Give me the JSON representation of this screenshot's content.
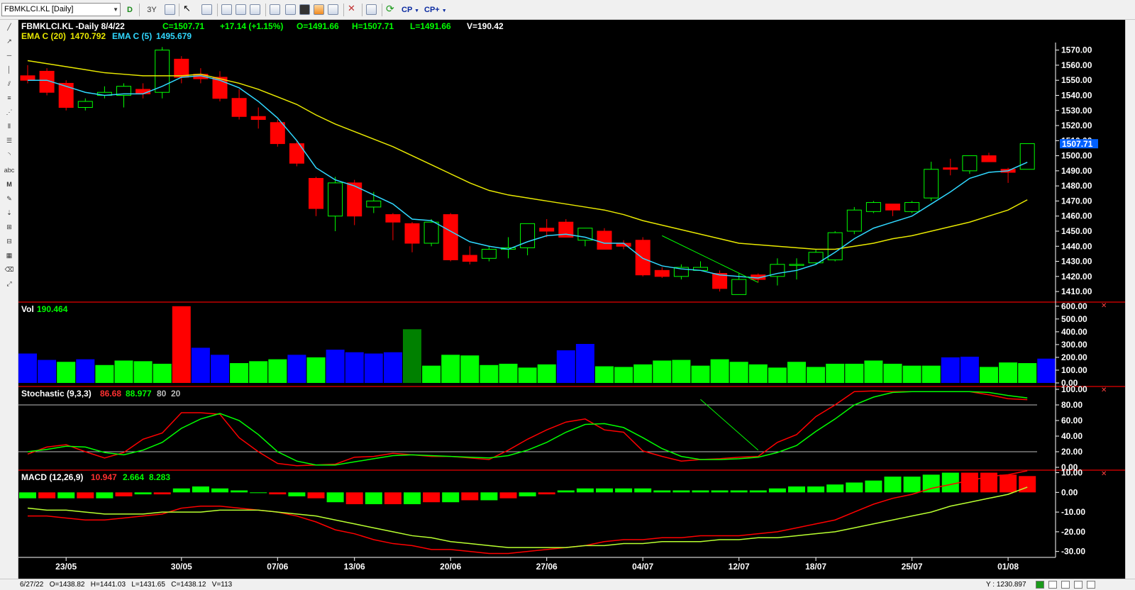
{
  "symbol_selector": {
    "value": "FBMKLCI.KL [Daily]"
  },
  "toolbar": {
    "period_label": "D",
    "range_label": "3Y",
    "cp_label": "CP",
    "cp_plus_label": "CP+"
  },
  "left_tools": {
    "text_tool_label": "abc",
    "m_tool_label": "M"
  },
  "header": {
    "title": "FBMKLCI.KL -Daily  8/4/22",
    "close": "C=1507.71",
    "change": "+17.14 (+1.15%)",
    "open": "O=1491.66",
    "high": "H=1507.71",
    "low": "L=1491.66",
    "volume": "V=190.42",
    "ema20_label": "EMA C (20)",
    "ema20_value": "1470.792",
    "ema5_label": "EMA C (5)",
    "ema5_value": "1495.679"
  },
  "panes": {
    "volume": {
      "label": "Vol",
      "value": "190.464"
    },
    "stochastic": {
      "label": "Stochastic (9,3,3)",
      "k": "86.68",
      "d": "88.977",
      "upper": "80",
      "lower": "20"
    },
    "macd": {
      "label": "MACD (12,26,9)",
      "macd": "10.947",
      "signal": "2.664",
      "hist": "8.283"
    }
  },
  "price_marker": "1507.71",
  "colors": {
    "up": "#00ff00",
    "down": "#ff0000",
    "ema20": "#e8e800",
    "ema5": "#30d8ff",
    "vol_blue": "#0000ff",
    "vol_dkgreen": "#008000",
    "grid": "#bbbbbb",
    "separator": "#c00000"
  },
  "status": {
    "ohlc": "6/27/22   O=1438.82   H=1441.03   L=1431.65   C=1438.12   V=113",
    "y_readout": "Y : 1230.897"
  },
  "chart_data": {
    "type": "candlestick",
    "x_labels": [
      "23/05",
      "30/05",
      "07/06",
      "13/06",
      "20/06",
      "27/06",
      "04/07",
      "12/07",
      "18/07",
      "25/07",
      "01/08"
    ],
    "x_label_index": [
      2,
      8,
      13,
      17,
      22,
      27,
      32,
      37,
      41,
      46,
      51
    ],
    "price": {
      "ylim": [
        1403,
        1575
      ],
      "ticks": [
        1410,
        1420,
        1430,
        1440,
        1450,
        1460,
        1470,
        1480,
        1490,
        1500,
        1510,
        1520,
        1530,
        1540,
        1550,
        1560,
        1570
      ],
      "ohlc": [
        [
          1553,
          1560,
          1548,
          1550
        ],
        [
          1556,
          1558,
          1540,
          1542
        ],
        [
          1548,
          1550,
          1530,
          1532
        ],
        [
          1532,
          1538,
          1530,
          1536
        ],
        [
          1540,
          1546,
          1538,
          1542
        ],
        [
          1540,
          1548,
          1532,
          1546
        ],
        [
          1544,
          1548,
          1538,
          1541
        ],
        [
          1542,
          1572,
          1538,
          1570
        ],
        [
          1564,
          1566,
          1548,
          1552
        ],
        [
          1554,
          1558,
          1548,
          1551
        ],
        [
          1552,
          1556,
          1536,
          1538
        ],
        [
          1538,
          1544,
          1524,
          1526
        ],
        [
          1526,
          1532,
          1518,
          1524
        ],
        [
          1522,
          1524,
          1506,
          1508
        ],
        [
          1508,
          1510,
          1493,
          1495
        ],
        [
          1485,
          1486,
          1460,
          1465
        ],
        [
          1460,
          1486,
          1450,
          1482
        ],
        [
          1482,
          1484,
          1454,
          1460
        ],
        [
          1466,
          1476,
          1462,
          1470
        ],
        [
          1461,
          1462,
          1444,
          1456
        ],
        [
          1455,
          1456,
          1436,
          1442
        ],
        [
          1442,
          1458,
          1440,
          1456
        ],
        [
          1461,
          1462,
          1430,
          1431
        ],
        [
          1434,
          1440,
          1428,
          1430
        ],
        [
          1432,
          1440,
          1430,
          1438
        ],
        [
          1438,
          1446,
          1432,
          1439
        ],
        [
          1439,
          1455,
          1434,
          1455
        ],
        [
          1452,
          1458,
          1446,
          1450
        ],
        [
          1456,
          1458,
          1446,
          1446
        ],
        [
          1444,
          1452,
          1440,
          1452
        ],
        [
          1450,
          1452,
          1440,
          1438
        ],
        [
          1442,
          1444,
          1438,
          1440
        ],
        [
          1444,
          1446,
          1420,
          1421
        ],
        [
          1424,
          1426,
          1419,
          1420
        ],
        [
          1420,
          1428,
          1418,
          1426
        ],
        [
          1424,
          1430,
          1424,
          1426
        ],
        [
          1422,
          1424,
          1410,
          1412
        ],
        [
          1408,
          1422,
          1408,
          1418
        ],
        [
          1421,
          1422,
          1416,
          1418
        ],
        [
          1420,
          1432,
          1414,
          1428
        ],
        [
          1428,
          1432,
          1418,
          1428
        ],
        [
          1429,
          1438,
          1428,
          1436
        ],
        [
          1431,
          1450,
          1430,
          1449
        ],
        [
          1450,
          1466,
          1448,
          1464
        ],
        [
          1463,
          1470,
          1462,
          1469
        ],
        [
          1468,
          1468,
          1460,
          1464
        ],
        [
          1463,
          1470,
          1462,
          1469
        ],
        [
          1472,
          1496,
          1470,
          1491
        ],
        [
          1492,
          1498,
          1487,
          1491
        ],
        [
          1490,
          1500,
          1488,
          1500
        ],
        [
          1500,
          1502,
          1496,
          1496
        ],
        [
          1491,
          1492,
          1482,
          1489
        ],
        [
          1491,
          1508,
          1491,
          1508
        ]
      ],
      "ema20": [
        1563,
        1561,
        1559,
        1557,
        1555,
        1554,
        1553,
        1553,
        1553,
        1554,
        1551,
        1548,
        1544,
        1539,
        1534,
        1527,
        1521,
        1516,
        1511,
        1506,
        1500,
        1494,
        1488,
        1482,
        1477,
        1474,
        1472,
        1470,
        1468,
        1466,
        1464,
        1461,
        1457,
        1454,
        1451,
        1448,
        1445,
        1442,
        1441,
        1440,
        1439,
        1438,
        1438,
        1440,
        1442,
        1445,
        1447,
        1450,
        1453,
        1456,
        1460,
        1464,
        1470.79
      ],
      "ema5": [
        1550,
        1550,
        1546,
        1542,
        1540,
        1541,
        1541,
        1546,
        1552,
        1553,
        1550,
        1545,
        1536,
        1525,
        1510,
        1492,
        1484,
        1480,
        1474,
        1468,
        1458,
        1457,
        1450,
        1443,
        1440,
        1438,
        1443,
        1447,
        1448,
        1446,
        1442,
        1442,
        1432,
        1427,
        1425,
        1424,
        1421,
        1420,
        1419,
        1422,
        1424,
        1428,
        1436,
        1445,
        1452,
        1456,
        1460,
        1468,
        1476,
        1485,
        1489,
        1490,
        1495.68
      ],
      "annotation_line": [
        [
          33,
          1447
        ],
        [
          38,
          1416
        ]
      ]
    },
    "volume": {
      "ylim": [
        0,
        610
      ],
      "ticks": [
        0,
        100,
        200,
        300,
        400,
        500,
        600
      ],
      "values": [
        230,
        180,
        165,
        185,
        140,
        175,
        170,
        150,
        600,
        275,
        220,
        155,
        170,
        185,
        220,
        200,
        260,
        240,
        230,
        240,
        420,
        135,
        220,
        215,
        140,
        150,
        120,
        145,
        255,
        305,
        130,
        125,
        145,
        175,
        180,
        135,
        185,
        165,
        145,
        120,
        165,
        125,
        150,
        150,
        175,
        150,
        135,
        135,
        200,
        205,
        125,
        160,
        155,
        190
      ],
      "colors": [
        "b",
        "b",
        "g",
        "b",
        "g",
        "g",
        "g",
        "g",
        "r",
        "b",
        "b",
        "g",
        "g",
        "g",
        "b",
        "g",
        "b",
        "b",
        "b",
        "b",
        "dg",
        "g",
        "g",
        "g",
        "g",
        "g",
        "g",
        "g",
        "b",
        "b",
        "g",
        "g",
        "g",
        "g",
        "g",
        "g",
        "g",
        "g",
        "g",
        "g",
        "g",
        "g",
        "g",
        "g",
        "g",
        "g",
        "g",
        "g",
        "b",
        "b",
        "g",
        "g",
        "g",
        "b"
      ]
    },
    "stochastic": {
      "ylim": [
        0,
        100
      ],
      "ticks": [
        0,
        20,
        40,
        60,
        80,
        100
      ],
      "k": [
        17,
        26,
        29,
        20,
        12,
        19,
        36,
        44,
        70,
        70,
        68,
        38,
        20,
        5,
        2,
        3,
        4,
        13,
        14,
        18,
        16,
        14,
        14,
        12,
        10,
        22,
        36,
        48,
        58,
        62,
        48,
        45,
        21,
        14,
        8,
        10,
        11,
        13,
        14,
        32,
        42,
        65,
        80,
        97,
        98,
        97,
        97,
        97,
        97,
        97,
        93,
        88,
        86.68
      ],
      "d": [
        20,
        23,
        27,
        26,
        19,
        16,
        22,
        32,
        50,
        62,
        69,
        60,
        42,
        20,
        8,
        3,
        3,
        7,
        11,
        15,
        16,
        15,
        14,
        13,
        12,
        15,
        22,
        32,
        45,
        55,
        56,
        51,
        38,
        24,
        14,
        10,
        10,
        11,
        13,
        19,
        28,
        46,
        62,
        80,
        90,
        96,
        97,
        97,
        97,
        97,
        96,
        92,
        88.98
      ],
      "annotation_line": [
        [
          35,
          87
        ],
        [
          38,
          22
        ]
      ]
    },
    "macd": {
      "ylim": [
        -33,
        12
      ],
      "ticks": [
        -30,
        -20,
        -10,
        0,
        10
      ],
      "macd": [
        -12,
        -12,
        -13,
        -14,
        -14,
        -13,
        -12,
        -11,
        -8,
        -7,
        -7,
        -8,
        -9,
        -10,
        -12,
        -15,
        -19,
        -21,
        -24,
        -26,
        -27,
        -29,
        -29,
        -30,
        -31,
        -31,
        -30,
        -29,
        -28,
        -27,
        -25,
        -24,
        -24,
        -23,
        -23,
        -22,
        -22,
        -22,
        -21,
        -20,
        -18,
        -16,
        -14,
        -10,
        -6,
        -3,
        -1,
        2,
        4,
        6,
        8,
        9,
        10.95
      ],
      "signal": [
        -8,
        -9,
        -9,
        -10,
        -11,
        -11,
        -11,
        -10,
        -10,
        -10,
        -9,
        -9,
        -9,
        -10,
        -11,
        -12,
        -14,
        -16,
        -18,
        -20,
        -22,
        -23,
        -25,
        -26,
        -27,
        -28,
        -28,
        -28,
        -28,
        -27,
        -27,
        -26,
        -26,
        -25,
        -25,
        -25,
        -24,
        -24,
        -23,
        -23,
        -22,
        -21,
        -20,
        -18,
        -16,
        -14,
        -12,
        -10,
        -7,
        -5,
        -3,
        -1,
        2.66
      ],
      "hist": [
        -3,
        -3,
        -3,
        -3,
        -3,
        -2,
        -1,
        -1,
        2,
        3,
        2,
        1,
        0,
        -1,
        -2,
        -3,
        -5,
        -6,
        -6,
        -6,
        -6,
        -5,
        -5,
        -4,
        -4,
        -3,
        -2,
        -1,
        1,
        2,
        2,
        2,
        2,
        1,
        1,
        1,
        1,
        1,
        1,
        2,
        3,
        3,
        4,
        5,
        6,
        8,
        8,
        9,
        10,
        10,
        10,
        9,
        8.28
      ]
    }
  }
}
